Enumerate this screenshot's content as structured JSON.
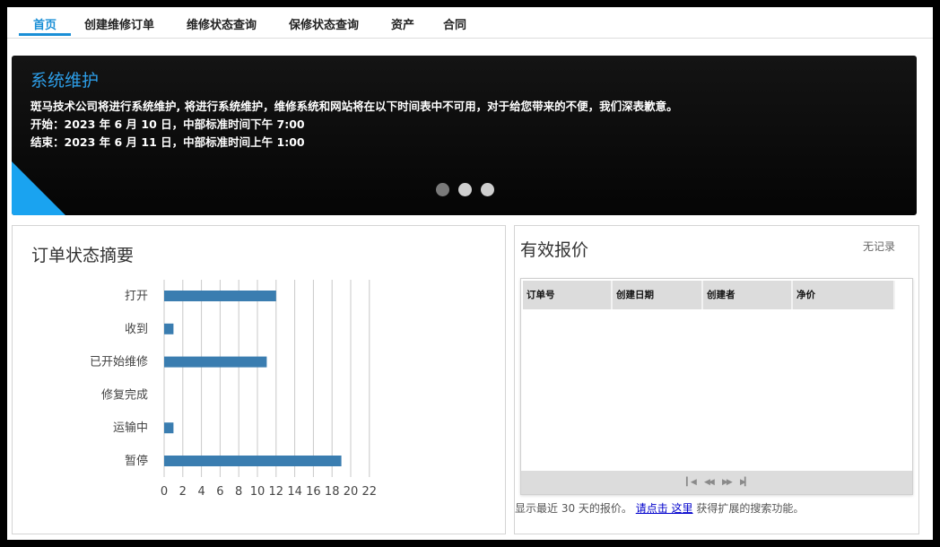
{
  "nav": {
    "items": [
      {
        "label": "首页",
        "active": true
      },
      {
        "label": "创建维修订单",
        "active": false
      },
      {
        "label": "维修状态查询",
        "active": false
      },
      {
        "label": "保修状态查询",
        "active": false
      },
      {
        "label": "资产",
        "active": false
      },
      {
        "label": "合同",
        "active": false
      }
    ]
  },
  "banner": {
    "title": "系统维护",
    "lines": [
      "斑马技术公司将进行系统维护, 将进行系统维护，维修系统和网站将在以下时间表中不可用，对于给您带来的不便，我们深表歉意。",
      "开始：2023 年 6 月 10 日，中部标准时间下午 7:00",
      "结束：2023 年 6 月 11 日，中部标准时间上午 1:00"
    ],
    "slides": 3,
    "active_slide": 0,
    "title_color": "#2d9ee8",
    "accent_color": "#1aa3f0"
  },
  "order_summary": {
    "title": "订单状态摘要"
  },
  "chart_data": {
    "type": "bar",
    "orientation": "horizontal",
    "title": "订单状态摘要",
    "categories": [
      "打开",
      "收到",
      "已开始维修",
      "修复完成",
      "运输中",
      "暂停"
    ],
    "values": [
      12,
      1,
      11,
      0,
      1,
      19
    ],
    "xlim": [
      0,
      22
    ],
    "xticks": [
      "0",
      "2",
      "4",
      "6",
      "8",
      "10",
      "12",
      "14",
      "16",
      "18",
      "20",
      "22"
    ],
    "grid": true,
    "bar_color": "#3a7db0"
  },
  "quotes": {
    "title": "有效报价",
    "no_records": "无记录",
    "columns": [
      "订单号",
      "创建日期",
      "创建者",
      "净价"
    ],
    "footnote_prefix": "显示最近 30 天的报价。",
    "footnote_link": "请点击 这里",
    "footnote_suffix": " 获得扩展的搜索功能。"
  }
}
